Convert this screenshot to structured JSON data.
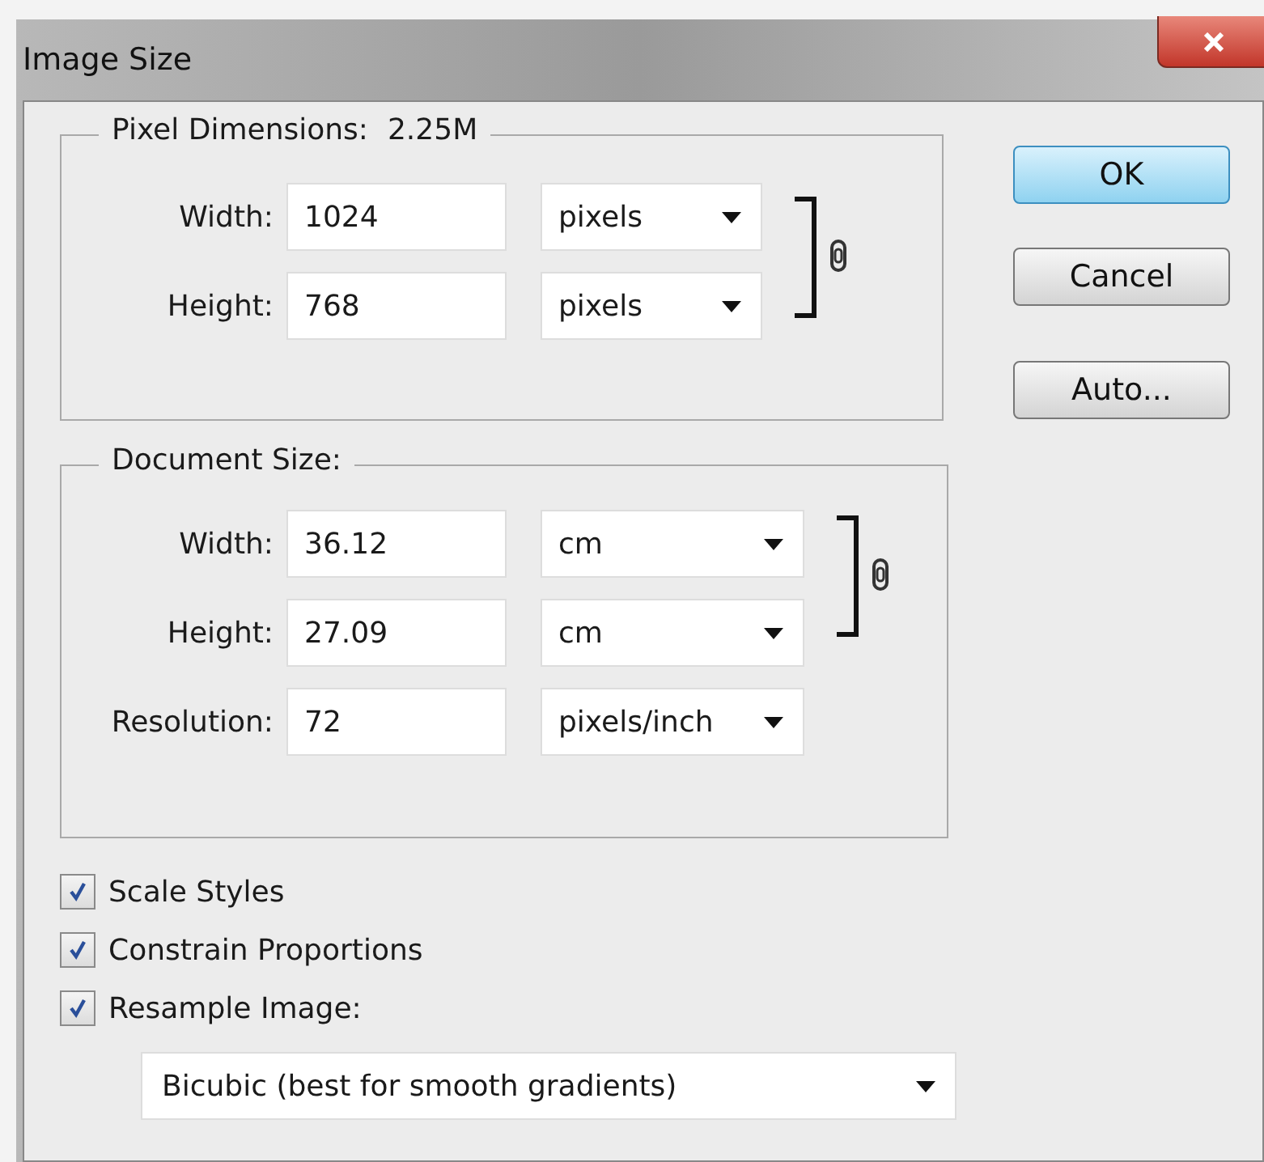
{
  "window": {
    "title": "Image Size"
  },
  "pixel_dimensions": {
    "label": "Pixel Dimensions:",
    "value": "2.25M",
    "linked": true,
    "rows": [
      {
        "label": "Width:",
        "value": "1024",
        "unit": "pixels"
      },
      {
        "label": "Height:",
        "value": "768",
        "unit": "pixels"
      }
    ]
  },
  "document_size": {
    "label": "Document Size:",
    "linked": true,
    "rows": [
      {
        "label": "Width:",
        "value": "36.12",
        "unit": "cm"
      },
      {
        "label": "Height:",
        "value": "27.09",
        "unit": "cm"
      },
      {
        "label": "Resolution:",
        "value": "72",
        "unit": "pixels/inch"
      }
    ]
  },
  "checkboxes": [
    {
      "label": "Scale Styles",
      "checked": true
    },
    {
      "label": "Constrain Proportions",
      "checked": true
    },
    {
      "label": "Resample Image:",
      "checked": true
    }
  ],
  "resample_method": "Bicubic (best for smooth gradients)",
  "buttons": [
    {
      "label": "OK",
      "default": true
    },
    {
      "label": "Cancel",
      "default": false
    },
    {
      "label": "Auto...",
      "default": false
    }
  ]
}
